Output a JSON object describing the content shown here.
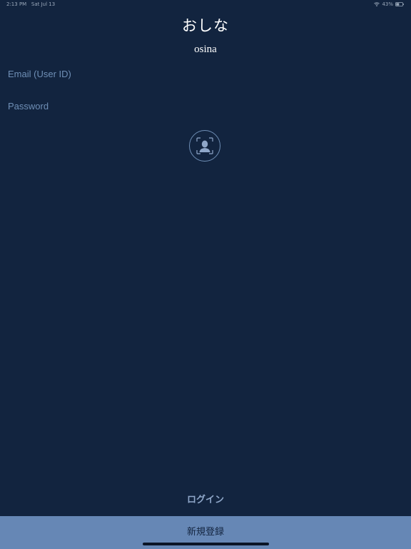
{
  "status_bar": {
    "time": "2:13 PM",
    "date": "Sat Jul 13",
    "battery": "43%",
    "icons": [
      "wifi-icon",
      "battery-icon"
    ]
  },
  "app": {
    "title": "おしな",
    "subtitle": "osina"
  },
  "form": {
    "email": {
      "value": "",
      "placeholder": "Email (User ID)"
    },
    "password": {
      "value": "",
      "placeholder": "Password"
    },
    "face_id_icon": "face-id-icon"
  },
  "actions": {
    "login_label": "ログイン",
    "register_label": "新規登録"
  },
  "colors": {
    "background": "#12243f",
    "accent": "#6f8fb6",
    "register_bar": "#6687b5",
    "text": "#ffffff"
  }
}
